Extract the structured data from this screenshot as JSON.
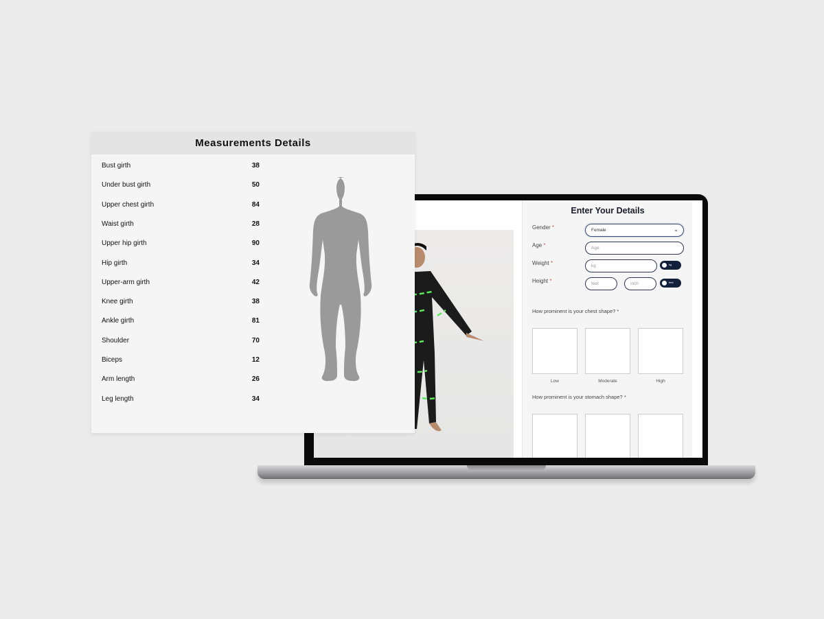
{
  "measurements": {
    "title": "Measurements Details",
    "rows": [
      {
        "label": "Bust girth",
        "value": "38"
      },
      {
        "label": "Under bust girth",
        "value": "50"
      },
      {
        "label": "Upper chest girth",
        "value": "84"
      },
      {
        "label": "Waist girth",
        "value": "28"
      },
      {
        "label": "Upper hip girth",
        "value": "90"
      },
      {
        "label": "Hip girth",
        "value": "34"
      },
      {
        "label": "Upper-arm girth",
        "value": "42"
      },
      {
        "label": "Knee girth",
        "value": "38"
      },
      {
        "label": "Ankle girth",
        "value": "81"
      },
      {
        "label": "Shoulder",
        "value": "70"
      },
      {
        "label": "Biceps",
        "value": "12"
      },
      {
        "label": "Arm length",
        "value": "26"
      },
      {
        "label": "Leg length",
        "value": "34"
      }
    ]
  },
  "form": {
    "title": "Enter Your Details",
    "gender": {
      "label": "Gender",
      "required": "*",
      "value": "Female"
    },
    "age": {
      "label": "Age",
      "required": "*",
      "placeholder": "Age"
    },
    "weight": {
      "label": "Weight",
      "required": "*",
      "placeholder": "kg",
      "toggle": "kg"
    },
    "height": {
      "label": "Height",
      "required": "*",
      "feet_placeholder": "feet",
      "inch_placeholder": "inch",
      "toggle": "feet"
    },
    "chest_question": "How prominent is your chest shape? *",
    "chest_options": [
      "Low",
      "Moderate",
      "High"
    ],
    "stomach_question": "How prominent is your stomach shape? *"
  },
  "colors": {
    "accent": "#13203b",
    "measure_line": "#5be85b",
    "silhouette": "#9a9a9a"
  }
}
